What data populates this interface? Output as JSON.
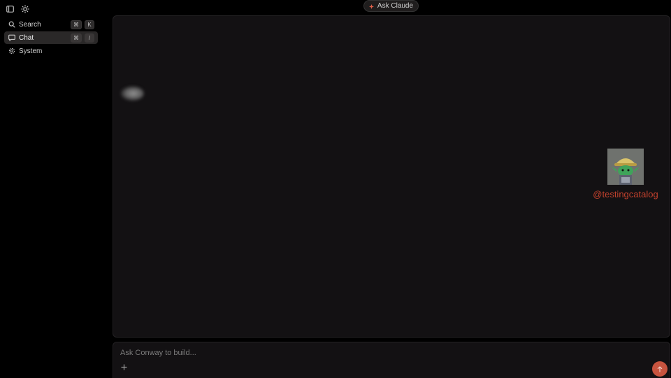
{
  "window": {
    "sidebar_toggle_icon": "sidebar-toggle-icon",
    "theme_icon": "sun-icon"
  },
  "ask_pill": {
    "label": "Ask Claude",
    "icon": "sparkle-icon",
    "icon_color": "#e0604a"
  },
  "sidebar": {
    "items": [
      {
        "label": "Search",
        "icon": "search-icon",
        "shortcut": [
          "⌘",
          "K"
        ]
      },
      {
        "label": "Chat",
        "icon": "chat-icon",
        "shortcut": [
          "⌘",
          "/"
        ],
        "active": true
      },
      {
        "label": "System",
        "icon": "gear-icon"
      }
    ]
  },
  "main": {
    "watermark": {
      "text": "@testingcatalog",
      "color": "#c2412d"
    }
  },
  "composer": {
    "placeholder": "Ask Conway to build...",
    "value": "",
    "add_icon": "plus-icon",
    "send_icon": "arrow-up-icon",
    "send_color": "#c8543f"
  }
}
